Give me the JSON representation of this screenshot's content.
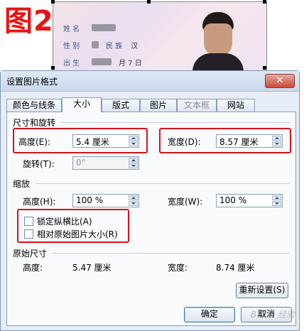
{
  "photo": {
    "figure_label": "图2",
    "card": {
      "name_label": "姓 名",
      "gender_label": "性 别",
      "ethnicity_label": "民 族",
      "ethnicity_value": "汉",
      "birth_label": "出 生",
      "birth_value": "月  7  日"
    }
  },
  "dialog": {
    "title": "设置图片格式",
    "close_symbol": "✕",
    "tabs": [
      "颜色与线条",
      "大小",
      "版式",
      "图片",
      "文本框",
      "网站"
    ],
    "active_tab": "大小",
    "disabled_tab": "文本框",
    "size_rotate": {
      "title": "尺寸和旋转",
      "height_label": "高度(E):",
      "height_value": "5.4 厘米",
      "width_label": "宽度(D):",
      "width_value": "8.57 厘米",
      "rotate_label": "旋转(T):",
      "rotate_value": "0°"
    },
    "scale": {
      "title": "缩放",
      "height_label": "高度(H):",
      "height_value": "100 %",
      "width_label": "宽度(W):",
      "width_value": "100 %",
      "lock_aspect_label": "锁定纵横比(A)",
      "relative_original_label": "相对原始图片大小(R)"
    },
    "original": {
      "title": "原始尺寸",
      "height_label": "高度:",
      "height_value": "5.47 厘米",
      "width_label": "宽度:",
      "width_value": "8.74 厘米"
    },
    "buttons": {
      "reset": "重新设置(S)",
      "ok": "确定",
      "cancel": "取消"
    },
    "watermark": "Baidu 经验"
  },
  "colors": {
    "highlight": "#d3121b",
    "figure_label": "#e81414"
  }
}
